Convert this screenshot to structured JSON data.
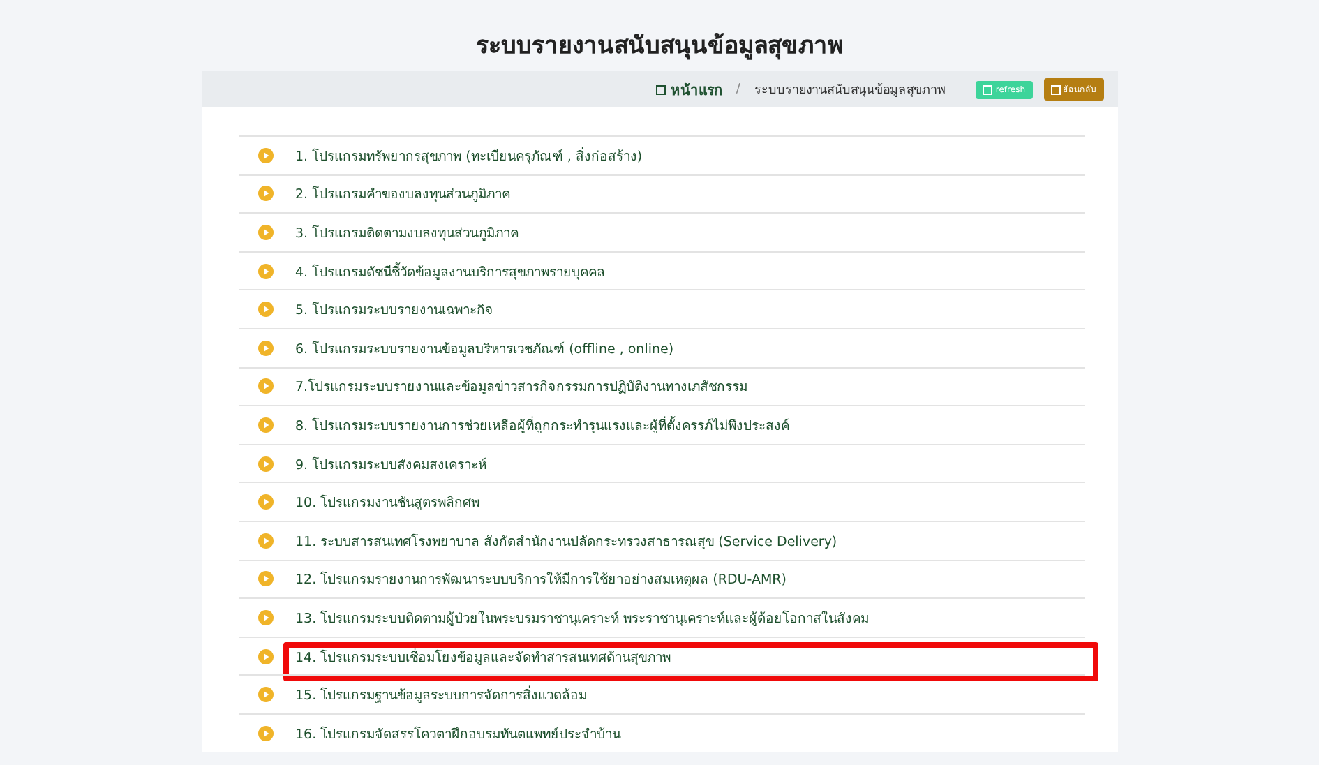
{
  "page_title": "ระบบรายงานสนับสนุนข้อมูลสุขภาพ",
  "breadcrumb_separator": "/",
  "breadcrumb": [
    {
      "label": "หน้าแรก",
      "kind": "home"
    },
    {
      "label": "ระบบรายงานสนับสนุนข้อมูลสุขภาพ",
      "kind": "current"
    }
  ],
  "buttons": [
    {
      "label": "refresh",
      "kind": "refresh"
    },
    {
      "label": "ย้อนกลับ",
      "kind": "back"
    }
  ],
  "programs": [
    {
      "label": "1. โปรแกรมทรัพยากรสุขภาพ (ทะเบียนครุภัณฑ์ , สิ่งก่อสร้าง)",
      "highlighted": false
    },
    {
      "label": "2. โปรแกรมคำของบลงทุนส่วนภูมิภาค",
      "highlighted": false
    },
    {
      "label": "3. โปรแกรมติดตามงบลงทุนส่วนภูมิภาค",
      "highlighted": false
    },
    {
      "label": "4. โปรแกรมดัชนีชี้วัดข้อมูลงานบริการสุขภาพรายบุคคล",
      "highlighted": false
    },
    {
      "label": "5. โปรแกรมระบบรายงานเฉพาะกิจ",
      "highlighted": false
    },
    {
      "label": "6. โปรแกรมระบบรายงานข้อมูลบริหารเวชภัณฑ์ (offline , online)",
      "highlighted": false
    },
    {
      "label": "7.โปรแกรมระบบรายงานและข้อมูลข่าวสารกิจกรรมการปฏิบัติงานทางเภสัชกรรม",
      "highlighted": false
    },
    {
      "label": "8. โปรแกรมระบบรายงานการช่วยเหลือผู้ที่ถูกกระทำรุนแรงและผู้ที่ตั้งครรภ์ไม่พึงประสงค์",
      "highlighted": false
    },
    {
      "label": "9. โปรแกรมระบบสังคมสงเคราะห์",
      "highlighted": false
    },
    {
      "label": "10. โปรแกรมงานชันสูตรพลิกศพ",
      "highlighted": false
    },
    {
      "label": "11. ระบบสารสนเทศโรงพยาบาล สังกัดสำนักงานปลัดกระทรวงสาธารณสุข (Service Delivery)",
      "highlighted": false
    },
    {
      "label": "12. โปรแกรมรายงานการพัฒนาระบบบริการให้มีการใช้ยาอย่างสมเหตุผล (RDU-AMR)",
      "highlighted": false
    },
    {
      "label": "13. โปรแกรมระบบติดตามผู้ป่วยในพระบรมราชานุเคราะห์ พระราชานุเคราะห์และผู้ด้อยโอกาสในสังคม",
      "highlighted": false
    },
    {
      "label": "14. โปรแกรมระบบเชื่อมโยงข้อมูลและจัดทำสารสนเทศด้านสุขภาพ",
      "highlighted": true
    },
    {
      "label": "15. โปรแกรมฐานข้อมูลระบบการจัดการสิ่งแวดล้อม",
      "highlighted": false
    },
    {
      "label": "16. โปรแกรมจัดสรรโควตาฝึกอบรมทันตแพทย์ประจำบ้าน",
      "highlighted": false
    }
  ]
}
